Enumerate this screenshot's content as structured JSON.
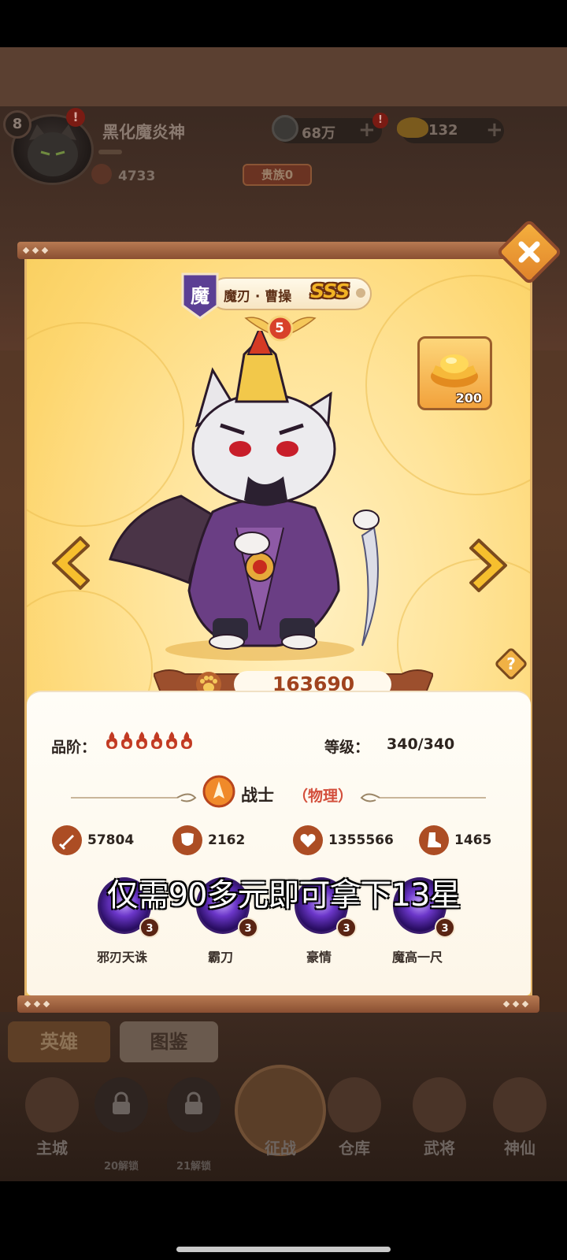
{
  "player": {
    "level": "8",
    "name": "黑化魔炎神",
    "power": "4733",
    "noble_label": "贵族0",
    "alert": "!"
  },
  "currency": {
    "coins": "68万",
    "ingots": "132",
    "plus": "+",
    "alert": "!"
  },
  "hero": {
    "faction": "魔",
    "name": "魔刃 · 曹操",
    "rank": "SSS",
    "star_level": "5",
    "power": "163690",
    "quality_label": "品阶：",
    "quality_flames": 6,
    "level_label": "等级：",
    "level_value": "340/340",
    "class_name": "战士",
    "class_type": "（物理）",
    "price": "200"
  },
  "stats": {
    "attack": "57804",
    "defense": "2162",
    "hp": "1355566",
    "speed": "1465"
  },
  "skills": [
    {
      "name": "邪刃天诛",
      "level": "3"
    },
    {
      "name": "霸刀",
      "level": "3"
    },
    {
      "name": "豪情",
      "level": "3"
    },
    {
      "name": "魔高一尺",
      "level": "3"
    }
  ],
  "tabs": {
    "hero": "英雄",
    "codex": "图鉴"
  },
  "nav": {
    "main_city": "主城",
    "locked_1": "20解锁",
    "locked_2": "21解锁",
    "campaign": "征战",
    "warehouse": "仓库",
    "generals": "武将",
    "immortals": "神仙"
  },
  "subtitle": "仅需90多元即可拿下13星",
  "help_symbol": "?",
  "colors": {
    "modal_bg": "#ffe49a",
    "frame": "#8a4f32",
    "accent": "#a0431e",
    "class_type": "#d34f3c"
  }
}
